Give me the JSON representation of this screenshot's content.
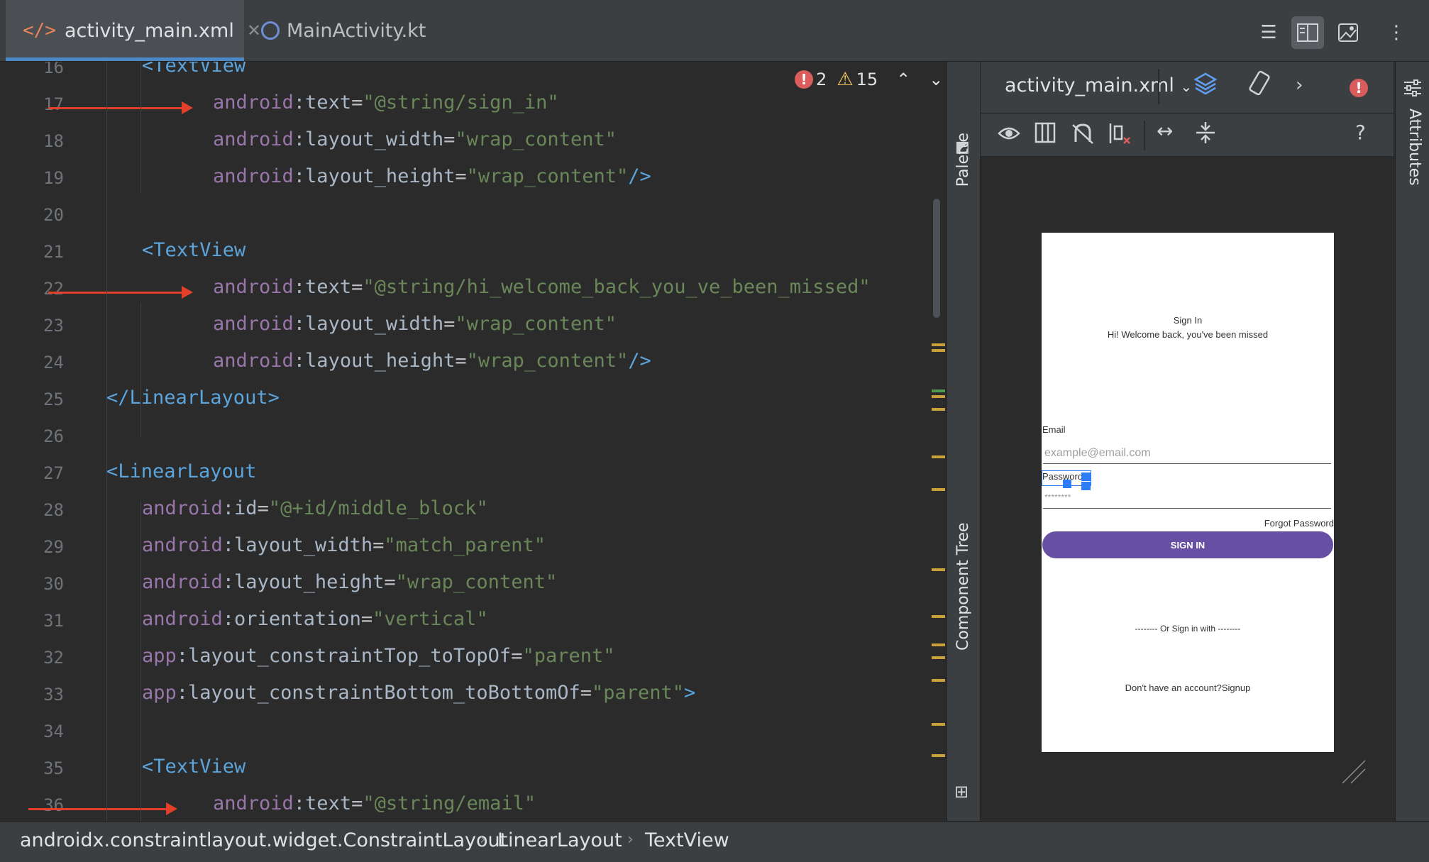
{
  "tabs": [
    {
      "label": "activity_main.xml",
      "icon": "xml-code-icon",
      "active": true
    },
    {
      "label": "MainActivity.kt",
      "icon": "kotlin-file-icon",
      "active": false
    }
  ],
  "toolbar": {
    "icons": [
      "code-view-icon",
      "split-view-icon",
      "design-view-icon",
      "more-options-icon"
    ]
  },
  "inspections": {
    "errors": "2",
    "warnings": "15"
  },
  "editor": {
    "lines": [
      {
        "num": "16",
        "indent": 2,
        "tokens": [
          {
            "t": "<TextView",
            "c": "tag"
          }
        ]
      },
      {
        "num": "17",
        "indent": 4,
        "tokens": [
          {
            "t": "android",
            "c": "ns"
          },
          {
            "t": ":text",
            "c": "attr"
          },
          {
            "t": "=",
            "c": "eq"
          },
          {
            "t": "\"@string/sign_in\"",
            "c": "val"
          }
        ]
      },
      {
        "num": "18",
        "indent": 4,
        "tokens": [
          {
            "t": "android",
            "c": "ns"
          },
          {
            "t": ":layout_width",
            "c": "attr"
          },
          {
            "t": "=",
            "c": "eq"
          },
          {
            "t": "\"wrap_content\"",
            "c": "val"
          }
        ]
      },
      {
        "num": "19",
        "indent": 4,
        "tokens": [
          {
            "t": "android",
            "c": "ns"
          },
          {
            "t": ":layout_height",
            "c": "attr"
          },
          {
            "t": "=",
            "c": "eq"
          },
          {
            "t": "\"wrap_content\"",
            "c": "val"
          },
          {
            "t": "/>",
            "c": "tag"
          }
        ]
      },
      {
        "num": "20",
        "indent": 0,
        "tokens": []
      },
      {
        "num": "21",
        "indent": 2,
        "tokens": [
          {
            "t": "<TextView",
            "c": "tag"
          }
        ]
      },
      {
        "num": "22",
        "indent": 4,
        "tokens": [
          {
            "t": "android",
            "c": "ns"
          },
          {
            "t": ":text",
            "c": "attr"
          },
          {
            "t": "=",
            "c": "eq"
          },
          {
            "t": "\"@string/hi_welcome_back_you_ve_been_missed\"",
            "c": "val"
          }
        ]
      },
      {
        "num": "23",
        "indent": 4,
        "tokens": [
          {
            "t": "android",
            "c": "ns"
          },
          {
            "t": ":layout_width",
            "c": "attr"
          },
          {
            "t": "=",
            "c": "eq"
          },
          {
            "t": "\"wrap_content\"",
            "c": "val"
          }
        ]
      },
      {
        "num": "24",
        "indent": 4,
        "tokens": [
          {
            "t": "android",
            "c": "ns"
          },
          {
            "t": ":layout_height",
            "c": "attr"
          },
          {
            "t": "=",
            "c": "eq"
          },
          {
            "t": "\"wrap_content\"",
            "c": "val"
          },
          {
            "t": "/>",
            "c": "tag"
          }
        ]
      },
      {
        "num": "25",
        "indent": 1,
        "tokens": [
          {
            "t": "</LinearLayout>",
            "c": "tag"
          }
        ]
      },
      {
        "num": "26",
        "indent": 0,
        "tokens": []
      },
      {
        "num": "27",
        "indent": 1,
        "tokens": [
          {
            "t": "<LinearLayout",
            "c": "tag"
          }
        ]
      },
      {
        "num": "28",
        "indent": 2,
        "tokens": [
          {
            "t": "android",
            "c": "ns"
          },
          {
            "t": ":id",
            "c": "attr"
          },
          {
            "t": "=",
            "c": "eq"
          },
          {
            "t": "\"@+id/middle_block\"",
            "c": "val"
          }
        ]
      },
      {
        "num": "29",
        "indent": 2,
        "tokens": [
          {
            "t": "android",
            "c": "ns"
          },
          {
            "t": ":layout_width",
            "c": "attr"
          },
          {
            "t": "=",
            "c": "eq"
          },
          {
            "t": "\"match_parent\"",
            "c": "val"
          }
        ]
      },
      {
        "num": "30",
        "indent": 2,
        "tokens": [
          {
            "t": "android",
            "c": "ns"
          },
          {
            "t": ":layout_height",
            "c": "attr"
          },
          {
            "t": "=",
            "c": "eq"
          },
          {
            "t": "\"wrap_content\"",
            "c": "val"
          }
        ]
      },
      {
        "num": "31",
        "indent": 2,
        "tokens": [
          {
            "t": "android",
            "c": "ns"
          },
          {
            "t": ":orientation",
            "c": "attr"
          },
          {
            "t": "=",
            "c": "eq"
          },
          {
            "t": "\"vertical\"",
            "c": "val"
          }
        ]
      },
      {
        "num": "32",
        "indent": 2,
        "tokens": [
          {
            "t": "app",
            "c": "ns"
          },
          {
            "t": ":layout_constraintTop_toTopOf",
            "c": "attr"
          },
          {
            "t": "=",
            "c": "eq"
          },
          {
            "t": "\"parent\"",
            "c": "val"
          }
        ]
      },
      {
        "num": "33",
        "indent": 2,
        "tokens": [
          {
            "t": "app",
            "c": "ns"
          },
          {
            "t": ":layout_constraintBottom_toBottomOf",
            "c": "attr"
          },
          {
            "t": "=",
            "c": "eq"
          },
          {
            "t": "\"parent\"",
            "c": "val"
          },
          {
            "t": ">",
            "c": "tag"
          }
        ]
      },
      {
        "num": "34",
        "indent": 0,
        "tokens": []
      },
      {
        "num": "35",
        "indent": 2,
        "tokens": [
          {
            "t": "<TextView",
            "c": "tag"
          }
        ]
      },
      {
        "num": "36",
        "indent": 4,
        "tokens": [
          {
            "t": "android",
            "c": "ns"
          },
          {
            "t": ":text",
            "c": "attr"
          },
          {
            "t": "=",
            "c": "eq"
          },
          {
            "t": "\"@string/email\"",
            "c": "val"
          }
        ]
      }
    ],
    "arrows_on_lines": [
      "17",
      "22",
      "36"
    ]
  },
  "side_tabs": {
    "palette": "Palette",
    "component_tree": "Component Tree",
    "attributes": "Attributes"
  },
  "design": {
    "file_selector": "activity_main.xml",
    "help": "?",
    "preview": {
      "title": "Sign In",
      "subtitle": "Hi! Welcome back, you've been missed",
      "email_label": "Email",
      "email_hint": "example@email.com",
      "password_label": "Password",
      "password_hint": "********",
      "forgot": "Forgot Password",
      "sign_in_button": "SIGN IN",
      "or_sign_in": "-------- Or Sign in with --------",
      "signup": "Don't have an account?Signup",
      "button_color": "#6750a4"
    }
  },
  "breadcrumb": [
    "androidx.constraintlayout.widget.ConstraintLayout",
    "LinearLayout",
    "TextView"
  ]
}
